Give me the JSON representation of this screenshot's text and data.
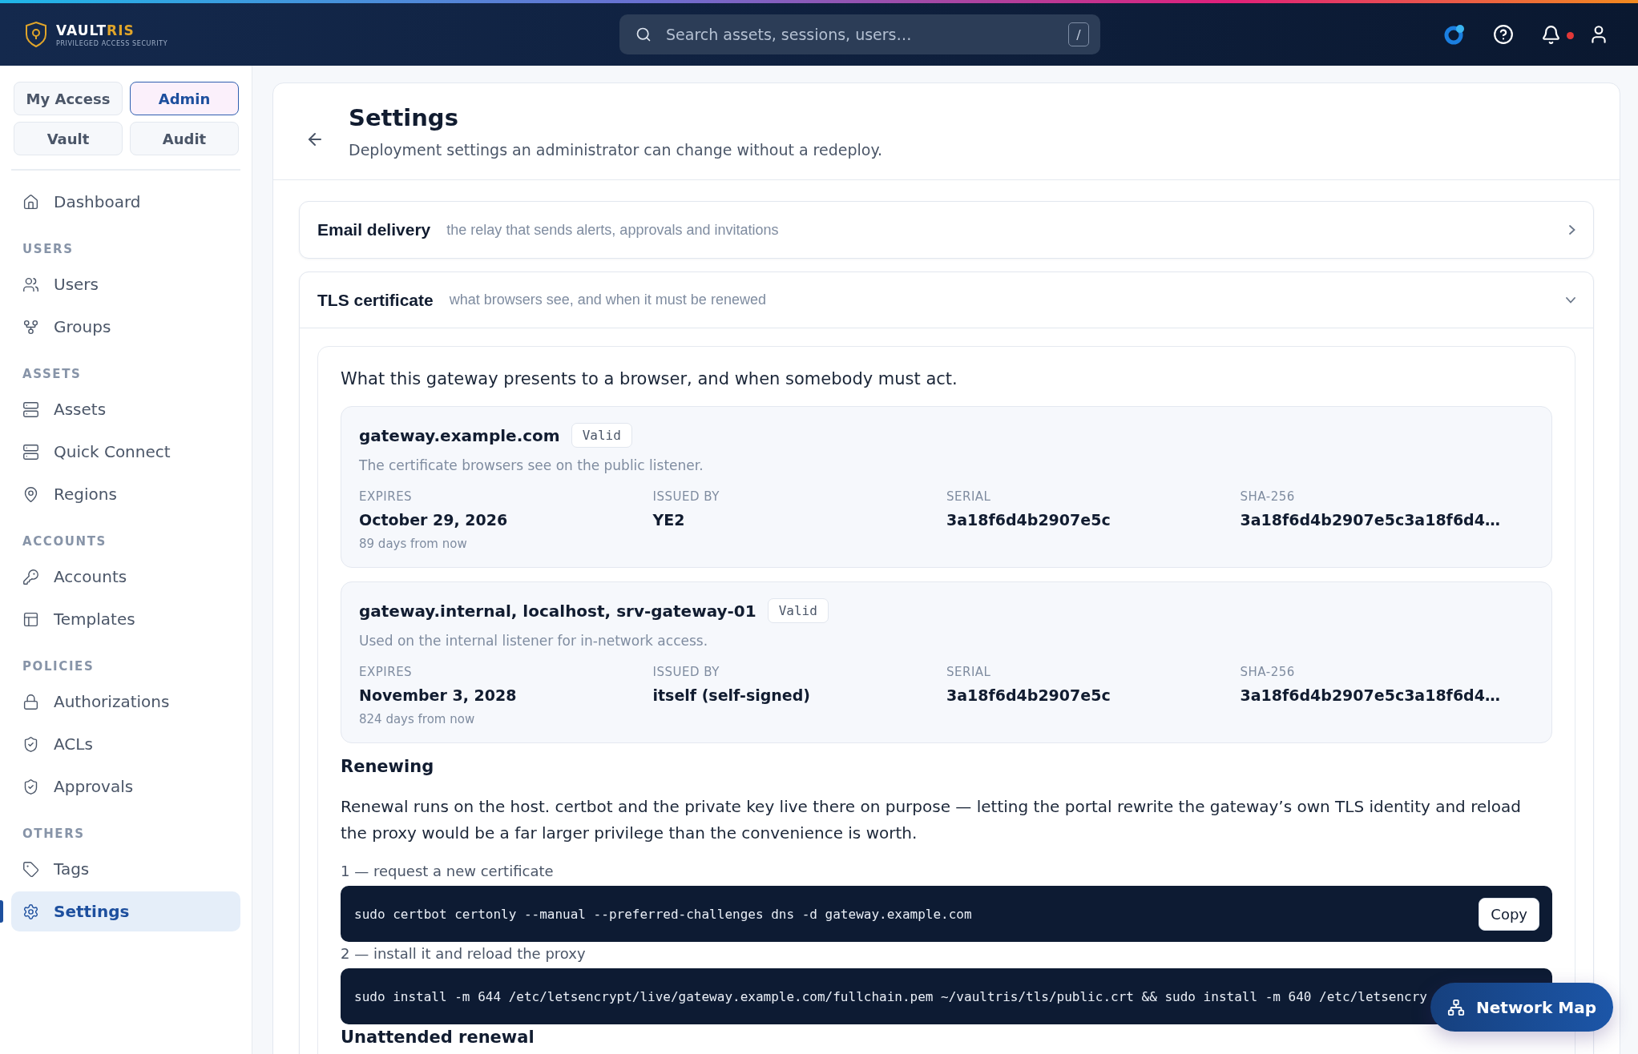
{
  "topbar": {
    "brand": {
      "name_main": "VAULT",
      "name_accent": "RIS",
      "tagline": "PRIVILEGED ACCESS SECURITY"
    },
    "search": {
      "placeholder": "Search assets, sessions, users…",
      "shortcut": "/"
    },
    "notifications": {
      "unread": true
    }
  },
  "sidebar": {
    "modes": [
      {
        "label": "My Access",
        "selected": false
      },
      {
        "label": "Admin",
        "selected": true
      },
      {
        "label": "Vault",
        "selected": false
      },
      {
        "label": "Audit",
        "selected": false
      }
    ],
    "sections": [
      {
        "items": [
          {
            "label": "Dashboard",
            "selected": false
          }
        ]
      },
      {
        "title": "USERS",
        "items": [
          {
            "label": "Users",
            "selected": false
          },
          {
            "label": "Groups",
            "selected": false
          }
        ]
      },
      {
        "title": "ASSETS",
        "items": [
          {
            "label": "Assets",
            "selected": false
          },
          {
            "label": "Quick Connect",
            "selected": false
          },
          {
            "label": "Regions",
            "selected": false
          }
        ]
      },
      {
        "title": "ACCOUNTS",
        "items": [
          {
            "label": "Accounts",
            "selected": false
          },
          {
            "label": "Templates",
            "selected": false
          }
        ]
      },
      {
        "title": "POLICIES",
        "items": [
          {
            "label": "Authorizations",
            "selected": false
          },
          {
            "label": "ACLs",
            "selected": false
          },
          {
            "label": "Approvals",
            "selected": false
          }
        ]
      },
      {
        "title": "OTHERS",
        "items": [
          {
            "label": "Tags",
            "selected": false
          },
          {
            "label": "Settings",
            "selected": true
          }
        ]
      }
    ]
  },
  "page": {
    "title": "Settings",
    "subtitle": "Deployment settings an administrator can change without a redeploy.",
    "sections": [
      {
        "title": "Email delivery",
        "description": "the relay that sends alerts, approvals and invitations",
        "expanded": false
      },
      {
        "title": "TLS certificate",
        "description": "what browsers see, and when it must be renewed",
        "expanded": true,
        "intro": "What this gateway presents to a browser, and when somebody must act.",
        "certificates": [
          {
            "name": "gateway.example.com",
            "status": "Valid",
            "description": "The certificate browsers see on the public listener.",
            "fields": [
              {
                "label": "EXPIRES",
                "value": "October 29, 2026",
                "note": "89 days from now"
              },
              {
                "label": "ISSUED BY",
                "value": "YE2"
              },
              {
                "label": "SERIAL",
                "value": "3a18f6d4b2907e5c"
              },
              {
                "label": "SHA-256",
                "value": "3a18f6d4b2907e5c3a18f6d4…"
              }
            ]
          },
          {
            "name": "gateway.internal, localhost, srv-gateway-01",
            "status": "Valid",
            "description": "Used on the internal listener for in-network access.",
            "fields": [
              {
                "label": "EXPIRES",
                "value": "November 3, 2028",
                "note": "824 days from now"
              },
              {
                "label": "ISSUED BY",
                "value": "itself (self-signed)"
              },
              {
                "label": "SERIAL",
                "value": "3a18f6d4b2907e5c"
              },
              {
                "label": "SHA-256",
                "value": "3a18f6d4b2907e5c3a18f6d4…"
              }
            ]
          }
        ],
        "renewing": {
          "heading": "Renewing",
          "paragraph": "Renewal runs on the host. certbot and the private key live there on purpose — letting the portal rewrite the gateway’s own TLS identity and reload the proxy would be a far larger privilege than the convenience is worth.",
          "steps": [
            {
              "label": "1 — request a new certificate",
              "command": "sudo certbot certonly --manual --preferred-challenges dns -d gateway.example.com",
              "copy": "Copy"
            },
            {
              "label": "2 — install it and reload the proxy",
              "command": "sudo install -m 644 /etc/letsencrypt/live/gateway.example.com/fullchain.pem ~/vaultris/tls/public.crt && sudo install -m 640 /etc/letsencry"
            }
          ]
        },
        "next_heading": "Unattended renewal"
      }
    ]
  },
  "floating_button": {
    "label": "Network Map"
  }
}
